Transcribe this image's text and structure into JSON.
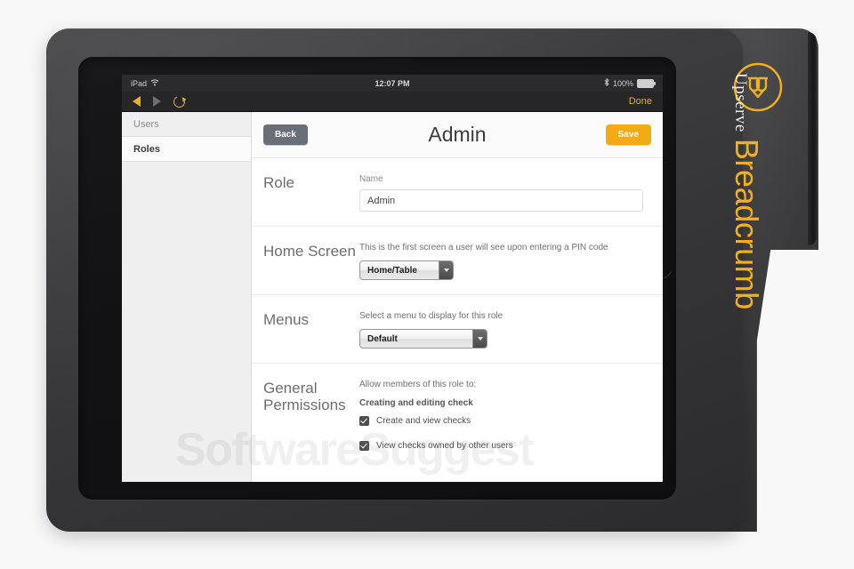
{
  "background_color": "#f7f7f7",
  "device": {
    "case_color": "#3c3c3f",
    "frame_color": "#151517",
    "home_button_name": "home-button"
  },
  "branding": {
    "logo_icon": "breadcrumb-logo-icon",
    "primary": "Upserve",
    "secondary": "Breadcrumb",
    "accent_color": "#f2b01c",
    "primary_color": "#e9e9e9"
  },
  "watermark": {
    "text": "SoftwareSuggest"
  },
  "status_bar": {
    "device_label": "iPad",
    "wifi_icon": "wifi-icon",
    "time": "12:07 PM",
    "bluetooth_icon": "bluetooth-icon",
    "battery_percent": "100%",
    "battery_icon": "battery-full-icon",
    "battery_level": 100,
    "background_color": "#2b2b2d"
  },
  "browser_toolbar": {
    "back_icon": "back-arrow-icon",
    "forward_icon": "forward-arrow-icon",
    "reload_icon": "reload-icon",
    "done_label": "Done",
    "accent_color": "#e8b021"
  },
  "sidebar": {
    "items": [
      {
        "label": "Users",
        "active": false
      },
      {
        "label": "Roles",
        "active": true
      }
    ]
  },
  "app_header": {
    "back_label": "Back",
    "title": "Admin",
    "save_label": "Save",
    "back_color": "#6a6e79",
    "save_color": "#f3ab14"
  },
  "sections": {
    "role": {
      "label": "Role",
      "field_label": "Name",
      "value": "Admin",
      "placeholder": "Name"
    },
    "home_screen": {
      "label": "Home Screen",
      "helper": "This is the first screen a user will see upon entering a PIN code",
      "selected": "Home/Table",
      "dropdown_icon": "chevron-down-icon"
    },
    "menus": {
      "label": "Menus",
      "helper": "Select a menu to display for this role",
      "selected": "Default",
      "dropdown_icon": "chevron-down-icon"
    },
    "general_permissions": {
      "label": "General Permissions",
      "helper": "Allow members of this role to:",
      "group_title": "Creating and editing check",
      "permissions": [
        {
          "label": "Create and view checks",
          "checked": true
        },
        {
          "label": "View checks owned by other users",
          "checked": true
        }
      ]
    }
  }
}
